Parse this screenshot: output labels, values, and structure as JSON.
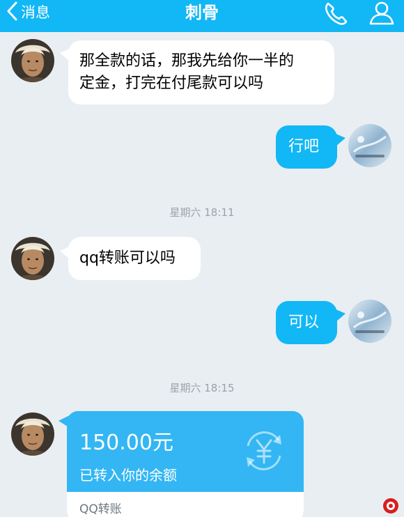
{
  "header": {
    "back_label": "消息",
    "title": "刺骨",
    "bg_color": "#12b7f5",
    "icons": [
      "chevron-left-icon",
      "phone-icon",
      "user-profile-icon"
    ]
  },
  "messages": [
    {
      "side": "left",
      "line1": "那全款的话，那我先给你一半的",
      "line2": "定金，打完在付尾款可以吗"
    },
    {
      "side": "right",
      "text": "行吧"
    },
    {
      "side": "left",
      "text": "qq转账可以吗"
    },
    {
      "side": "right",
      "text": "可以"
    }
  ],
  "timestamps": [
    "星期六 18:11",
    "星期六 18:15"
  ],
  "transfer": {
    "amount": "150.00元",
    "description": "已转入你的余额",
    "footer": "QQ转账",
    "icon": "yen-transfer-icon"
  },
  "colors": {
    "background": "#e9eef2",
    "accent": "#12b7f5",
    "transfer_card": "#33b6f3"
  }
}
